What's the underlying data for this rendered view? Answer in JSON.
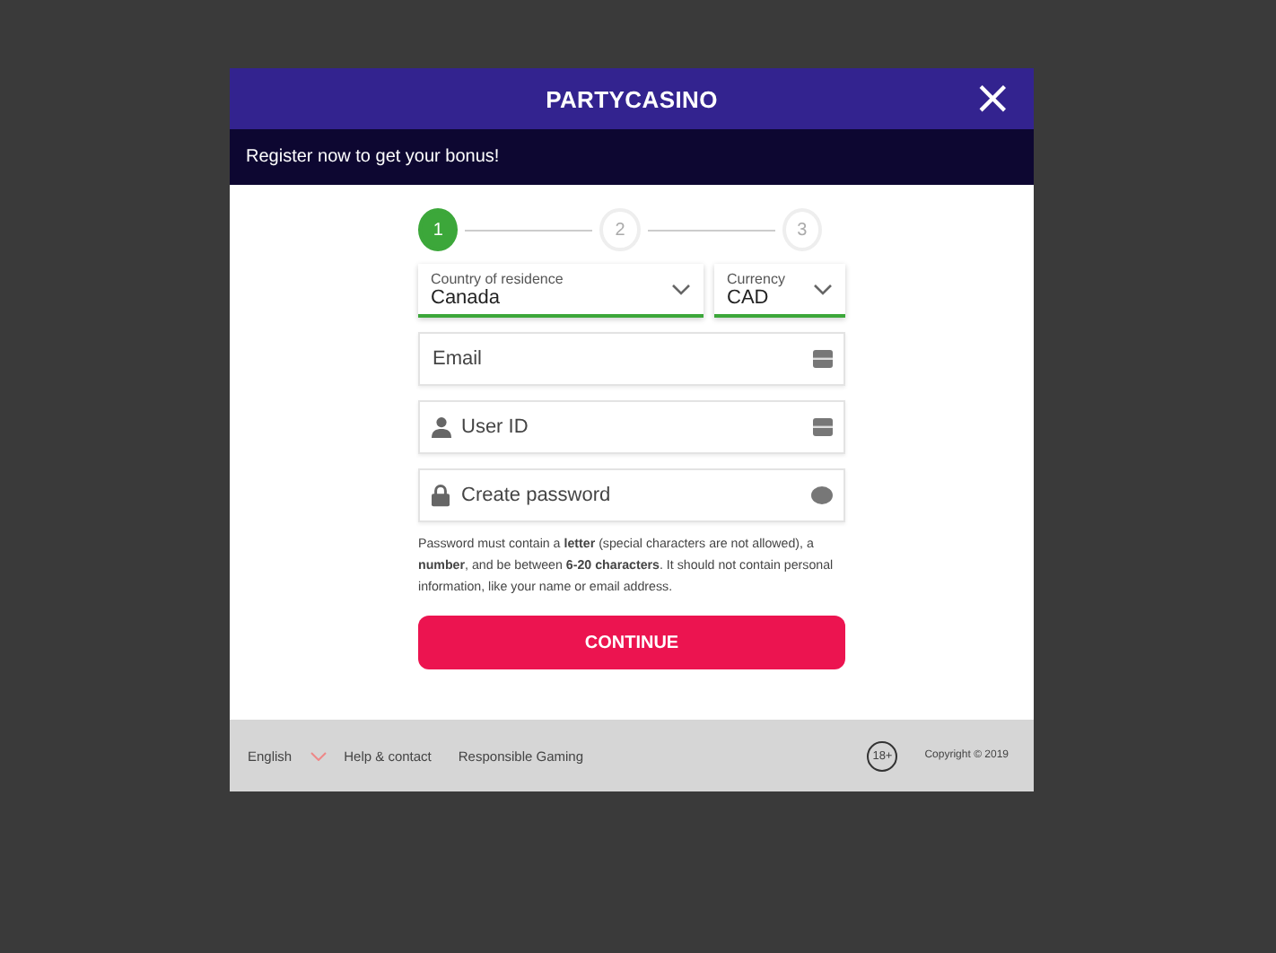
{
  "header": {
    "logo": "PARTYCASINO",
    "close": "×"
  },
  "banner": "Register now to get your bonus!",
  "steps": [
    {
      "label": "1",
      "selected": true
    },
    {
      "label": "2",
      "selected": false
    },
    {
      "label": "3",
      "selected": false
    }
  ],
  "selects": [
    {
      "label": "Country of residence",
      "value": "Canada"
    },
    {
      "label": "Currency",
      "value": "CAD"
    }
  ],
  "fields": [
    {
      "kind": "email",
      "placeholder": "Email"
    },
    {
      "kind": "user",
      "placeholder": "User ID"
    },
    {
      "kind": "password",
      "placeholder": "Create password"
    }
  ],
  "hint": "Password must contain a **letter** (special characters are not allowed), a **number**, and be between **6-20 characters**. It should not contain personal information, like your name or email address.",
  "button": "CONTINUE",
  "footer": {
    "language": "English",
    "links": [
      "Help & contact",
      "Responsible Gaming"
    ],
    "age": "18+",
    "copyright": "Copyright © 2019"
  }
}
